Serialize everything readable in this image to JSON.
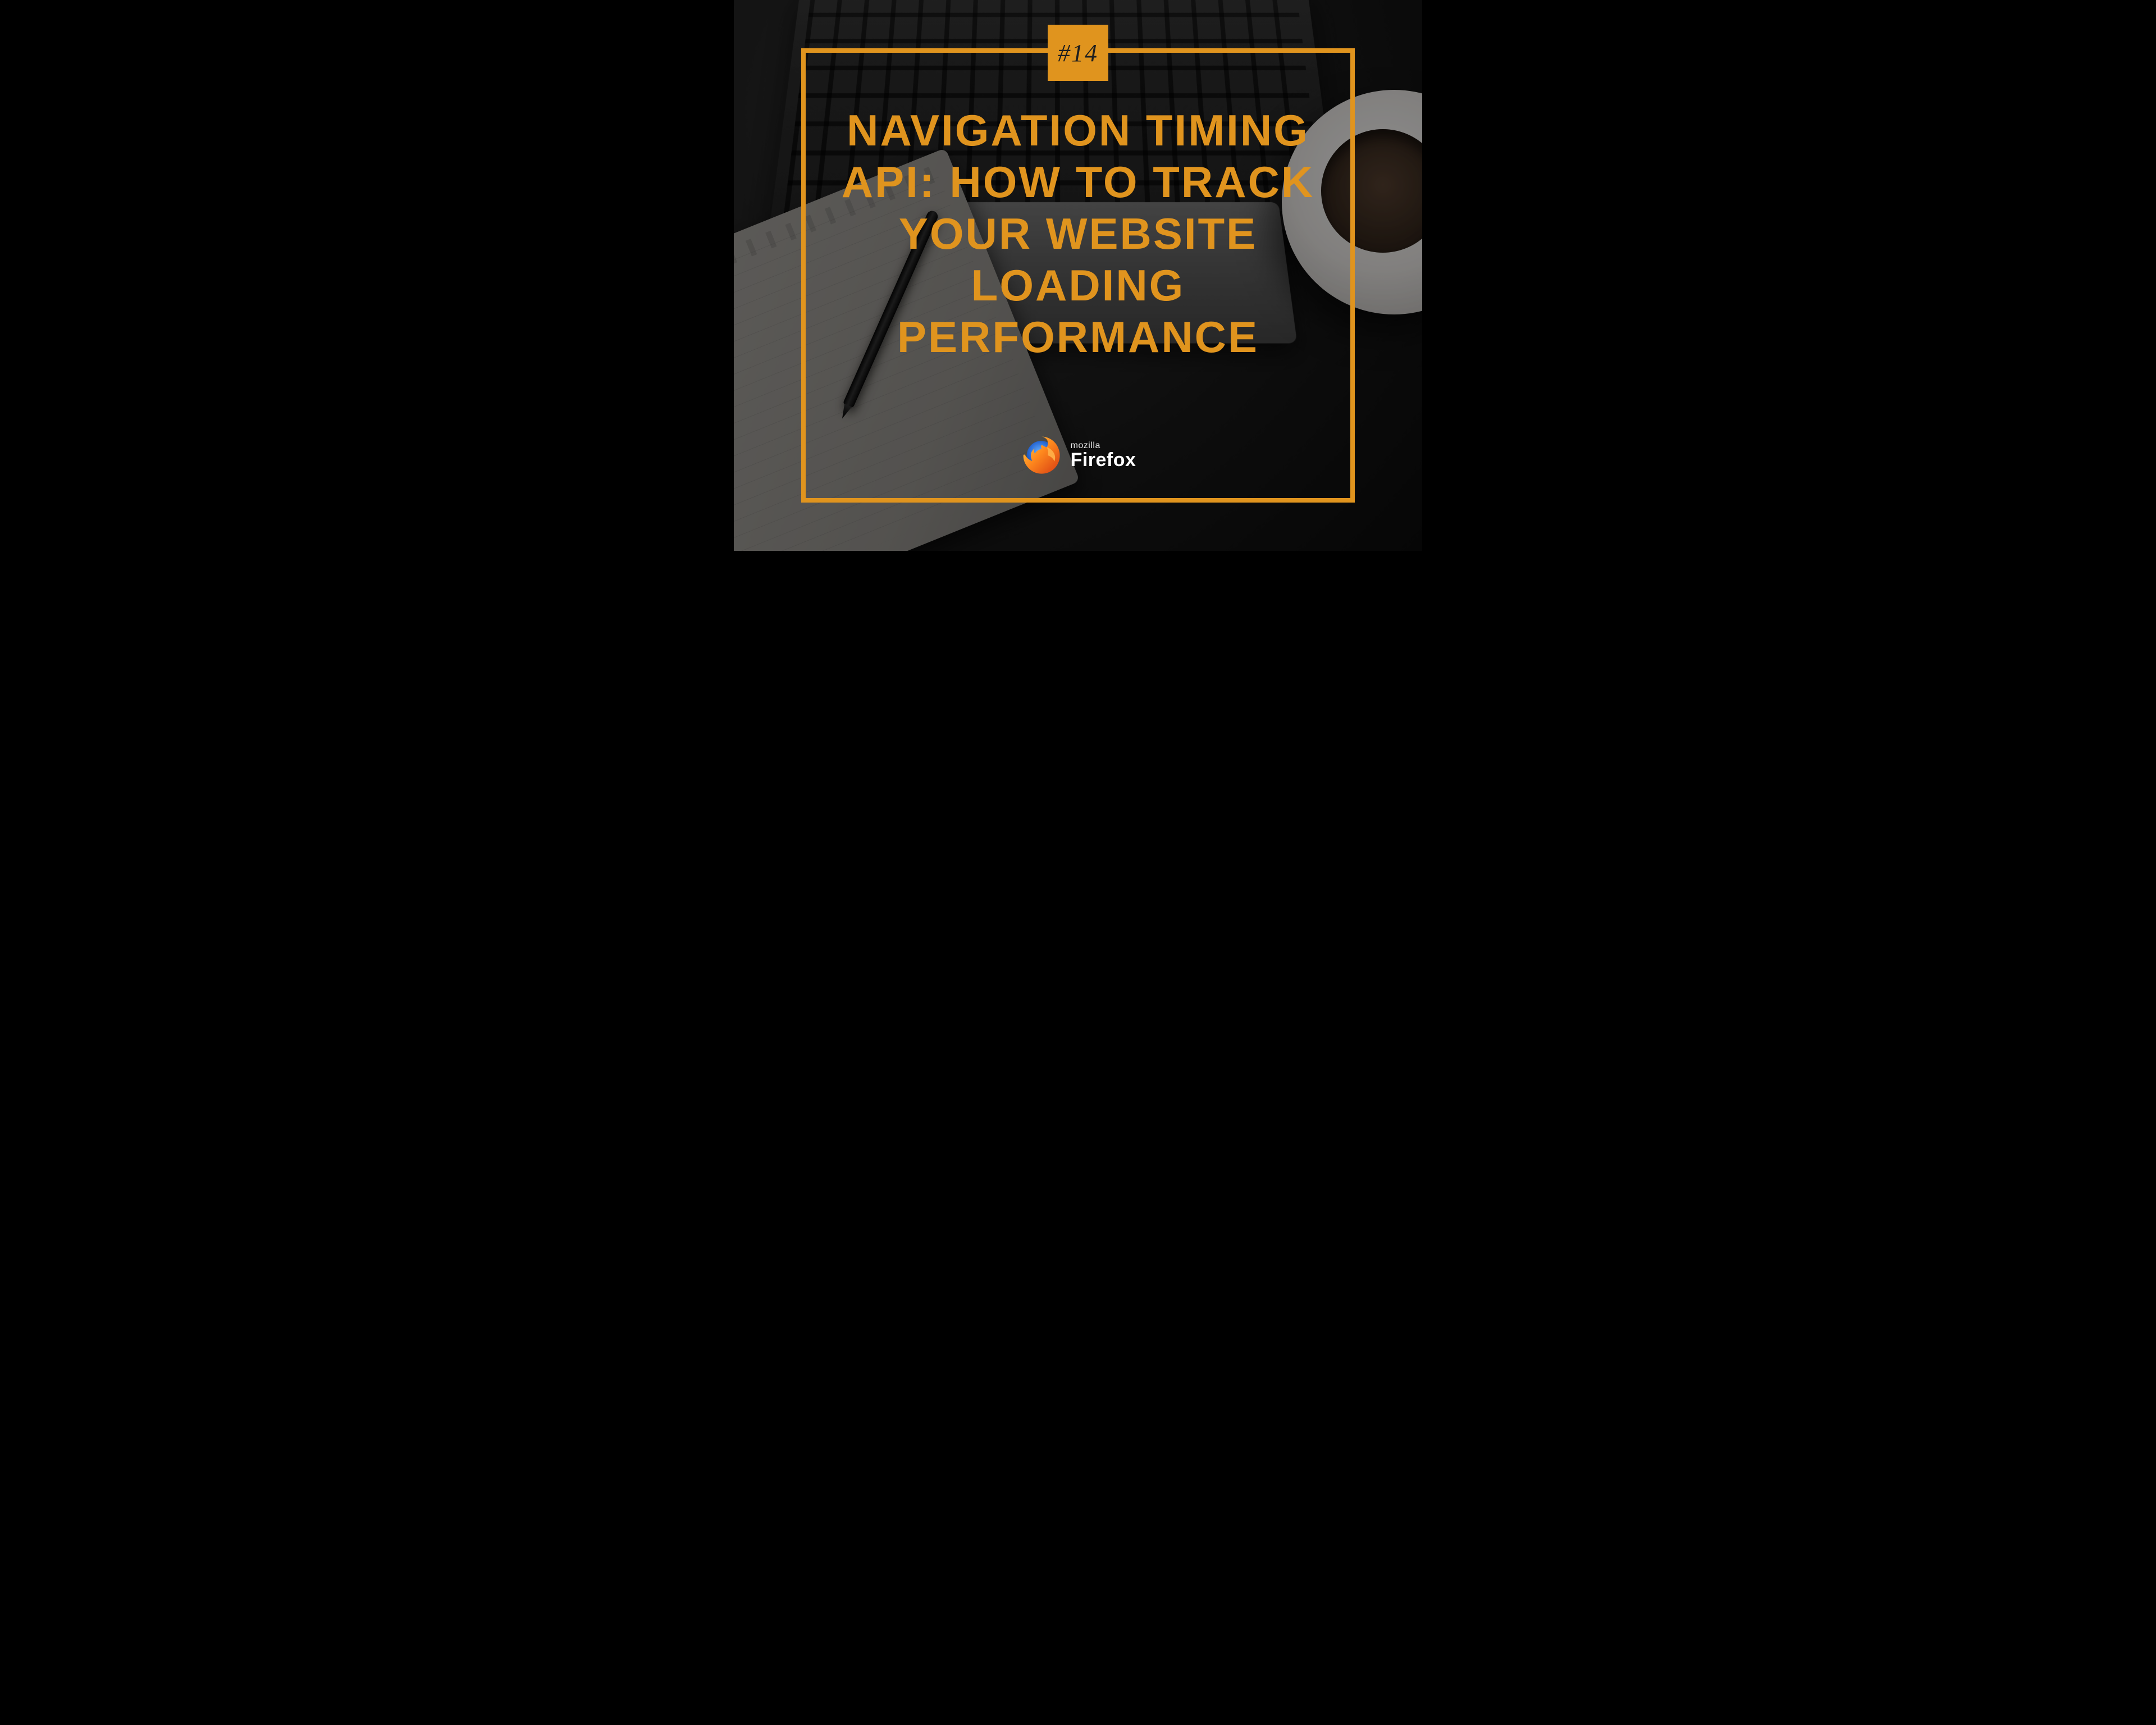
{
  "badge": {
    "label": "#14"
  },
  "title": "NAVIGATION TIMING API: HOW TO TRACK YOUR WEBSITE LOADING PERFORMANCE",
  "logo": {
    "small": "mozilla",
    "big": "Firefox",
    "icon_name": "firefox-icon"
  },
  "colors": {
    "accent": "#E0941E",
    "text_light": "#ffffff",
    "text_dark": "#1f1f1f"
  }
}
